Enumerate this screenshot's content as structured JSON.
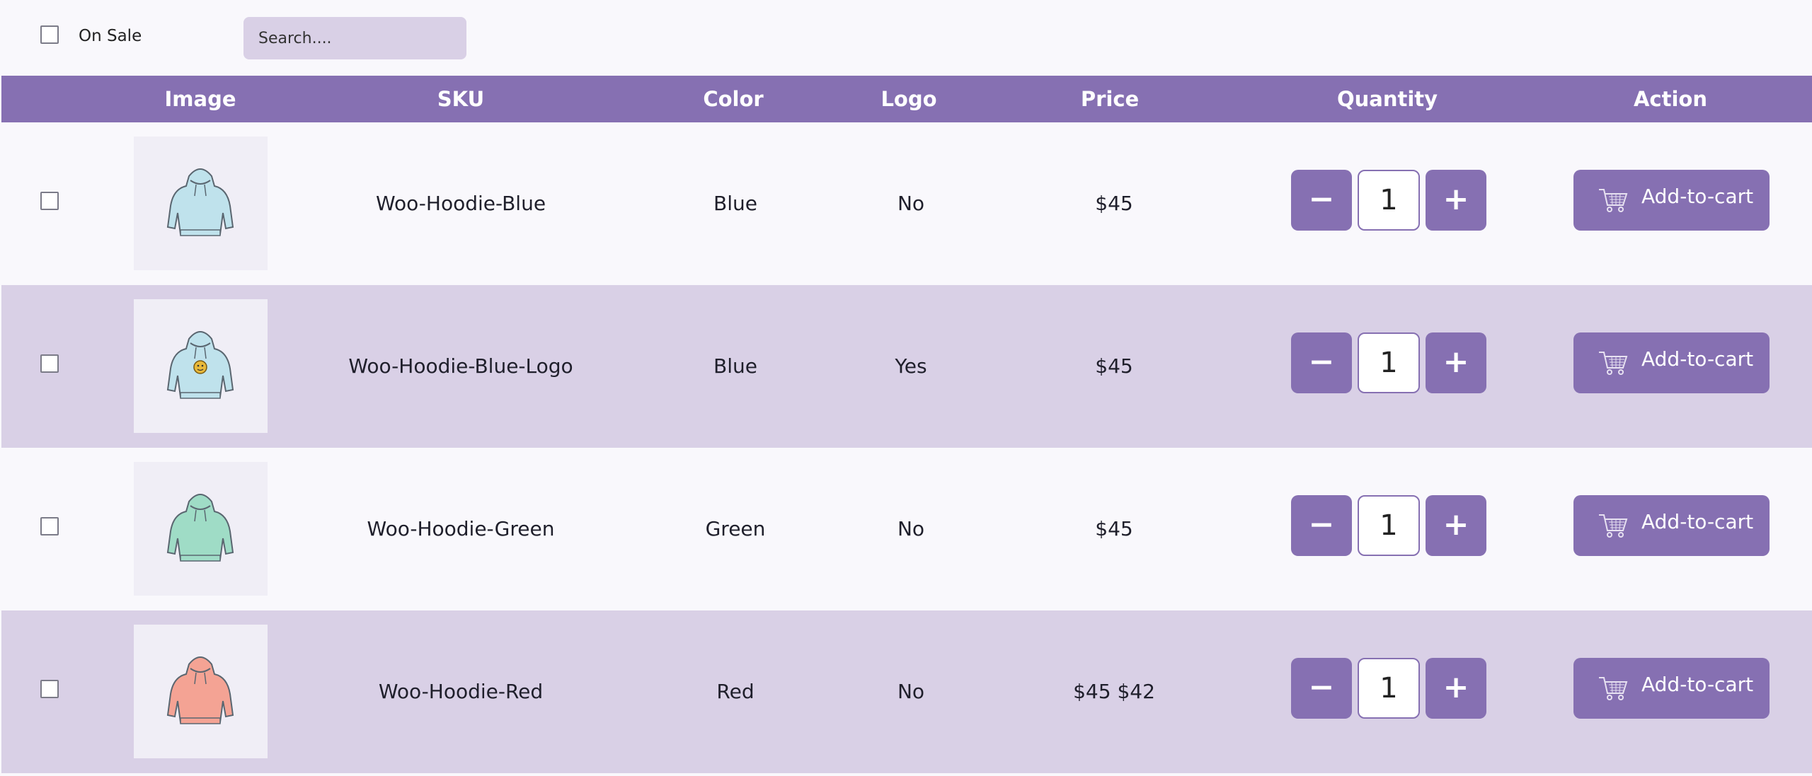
{
  "filters": {
    "on_sale_label": "On Sale",
    "search_placeholder": "Search...."
  },
  "table": {
    "columns": [
      "Image",
      "SKU",
      "Color",
      "Logo",
      "Price",
      "Quantity",
      "Action"
    ],
    "rows": [
      {
        "sku": "Woo-Hoodie-Blue",
        "color": "Blue",
        "logo": "No",
        "price": "$45",
        "quantity": "1",
        "action": "Add-to-cart",
        "hoodie_color": "#bfe2ec",
        "has_logo": false
      },
      {
        "sku": "Woo-Hoodie-Blue-Logo",
        "color": "Blue",
        "logo": "Yes",
        "price": "$45",
        "quantity": "1",
        "action": "Add-to-cart",
        "hoodie_color": "#bfe2ec",
        "has_logo": true
      },
      {
        "sku": "Woo-Hoodie-Green",
        "color": "Green",
        "logo": "No",
        "price": "$45",
        "quantity": "1",
        "action": "Add-to-cart",
        "hoodie_color": "#9fdcc6",
        "has_logo": false
      },
      {
        "sku": "Woo-Hoodie-Red",
        "color": "Red",
        "logo": "No",
        "price": "$45 $42",
        "quantity": "1",
        "action": "Add-to-cart",
        "hoodie_color": "#f4a394",
        "has_logo": false
      }
    ]
  },
  "quantity_controls": {
    "minus": "−",
    "plus": "+"
  },
  "colors": {
    "accent": "#8670b2",
    "row_alt": "#d9d0e6",
    "background": "#f9f8fc"
  },
  "icons": {
    "cart": "shopping-cart-icon"
  }
}
